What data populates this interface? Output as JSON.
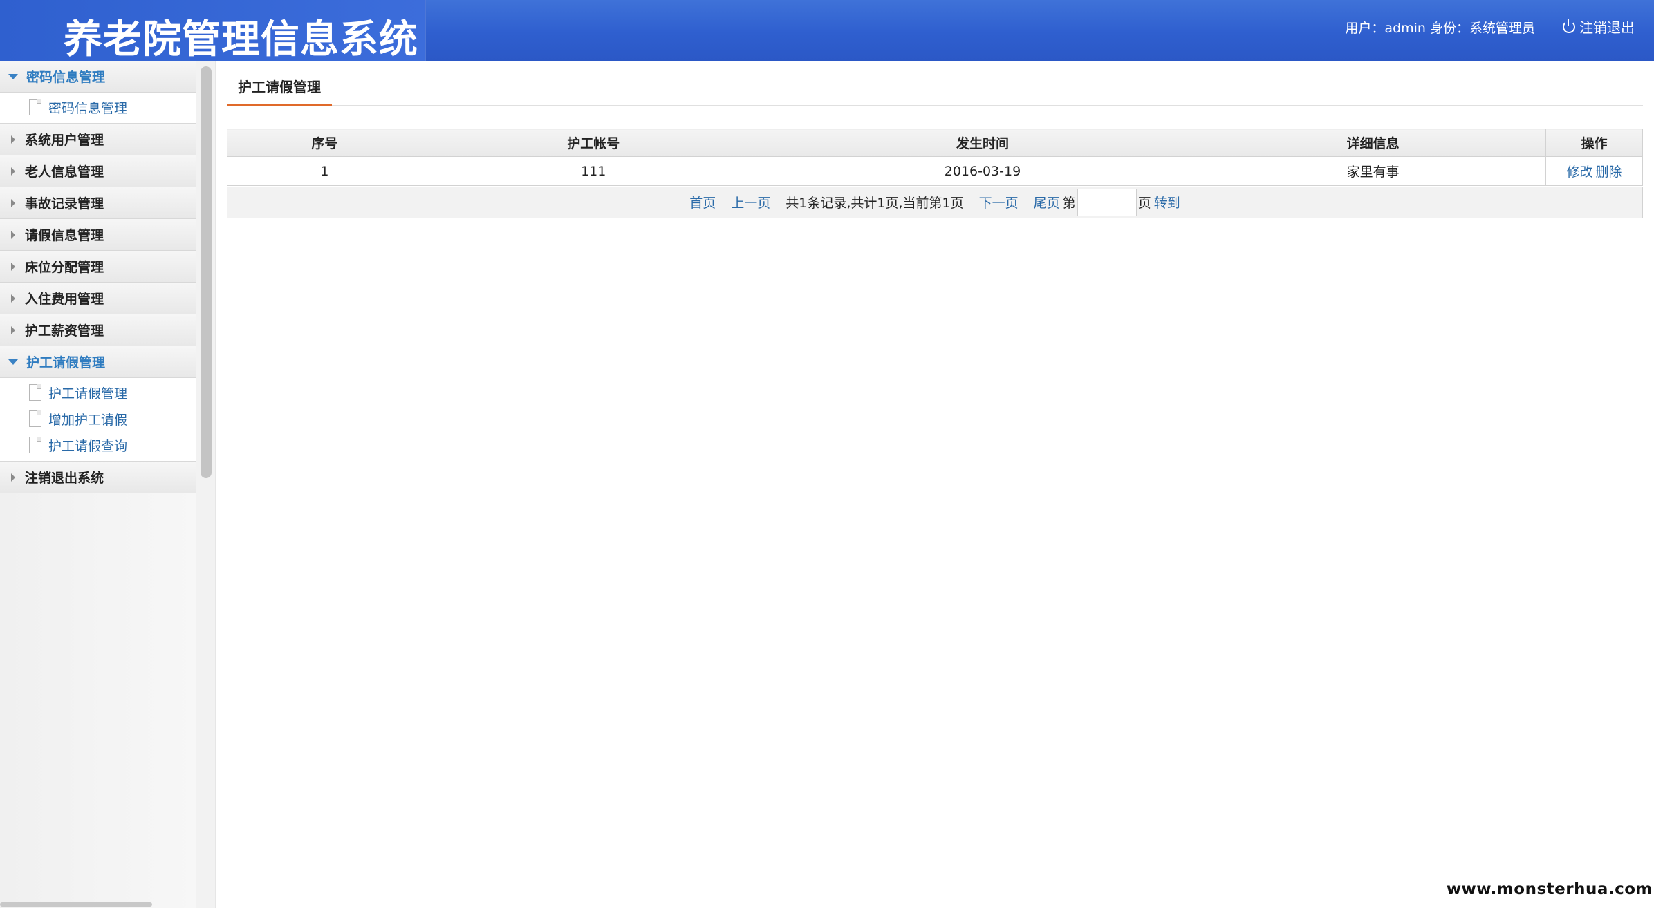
{
  "header": {
    "app_title": "养老院管理信息系统",
    "user_info": "用户：admin 身份：系统管理员",
    "logout_label": "注销退出"
  },
  "sidebar": {
    "groups": [
      {
        "label": "密码信息管理",
        "open": true,
        "items": [
          {
            "label": "密码信息管理"
          }
        ]
      },
      {
        "label": "系统用户管理",
        "open": false,
        "items": []
      },
      {
        "label": "老人信息管理",
        "open": false,
        "items": []
      },
      {
        "label": "事故记录管理",
        "open": false,
        "items": []
      },
      {
        "label": "请假信息管理",
        "open": false,
        "items": []
      },
      {
        "label": "床位分配管理",
        "open": false,
        "items": []
      },
      {
        "label": "入住费用管理",
        "open": false,
        "items": []
      },
      {
        "label": "护工薪资管理",
        "open": false,
        "items": []
      },
      {
        "label": "护工请假管理",
        "open": true,
        "items": [
          {
            "label": "护工请假管理"
          },
          {
            "label": "增加护工请假"
          },
          {
            "label": "护工请假查询"
          }
        ]
      },
      {
        "label": "注销退出系统",
        "open": false,
        "items": []
      }
    ]
  },
  "main": {
    "tab_label": "护工请假管理",
    "table": {
      "headers": [
        "序号",
        "护工帐号",
        "发生时间",
        "详细信息",
        "操作"
      ],
      "rows": [
        {
          "index": "1",
          "account": "111",
          "time": "2016-03-19",
          "detail": "家里有事",
          "edit": "修改",
          "delete": "删除"
        }
      ]
    },
    "pager": {
      "first": "首页",
      "prev": "上一页",
      "summary": "共1条记录,共计1页,当前第1页",
      "next": "下一页",
      "last": "尾页",
      "page_prefix": "第",
      "page_input_value": "",
      "page_suffix": "页",
      "go": "转到"
    }
  },
  "watermark": "www.monsterhua.com",
  "colors": {
    "header_blue": "#2f5fcf",
    "link_blue": "#2a6aa8",
    "active_group": "#2f7cc0",
    "tab_underline": "#e06a2a"
  }
}
